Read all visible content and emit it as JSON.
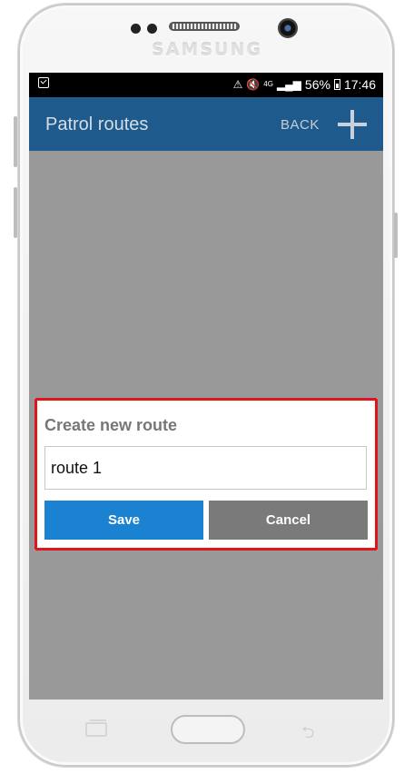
{
  "device": {
    "brand": "SAMSUNG"
  },
  "status_bar": {
    "signal_label": "4G",
    "battery_percent": "56%",
    "time": "17:46"
  },
  "app_bar": {
    "title": "Patrol routes",
    "back_label": "BACK",
    "add_icon": "plus-icon"
  },
  "dialog": {
    "title": "Create new route",
    "input_value": "route 1",
    "save_label": "Save",
    "cancel_label": "Cancel",
    "highlight_color": "#e0141c"
  },
  "colors": {
    "app_bar": "#1e5b8c",
    "save_button": "#1b82d1",
    "cancel_button": "#7a7a7a",
    "overlay": "#999999"
  }
}
